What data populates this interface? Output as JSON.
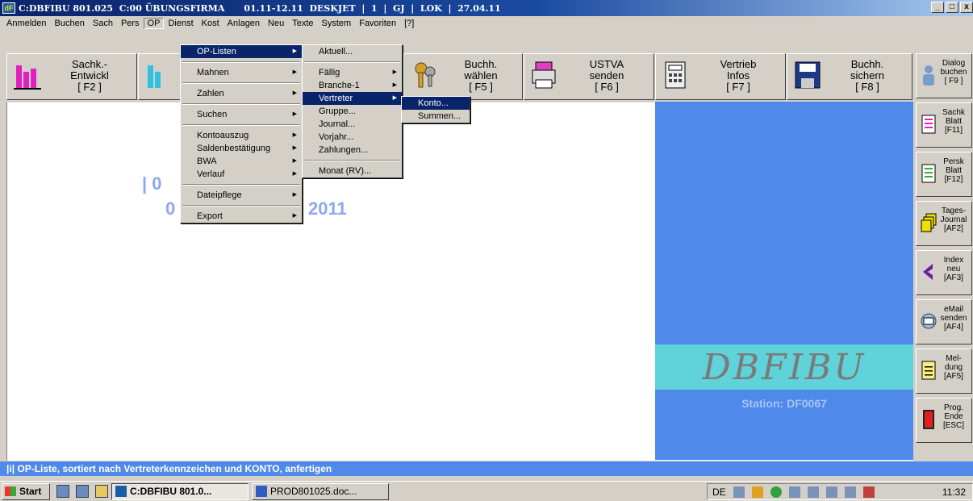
{
  "window": {
    "app_icon_label": "dF",
    "title_left": "C:DBFIBU 801.025  C:00 ÜBUNGSFIRMA",
    "title_right": "01.11-12.11  DESKJET  |  1  |  GJ  |  LOK  |  27.04.11",
    "minimize": "_",
    "maximize": "□",
    "close": "x"
  },
  "menubar": [
    "Anmelden",
    "Buchen",
    "Sach",
    "Pers",
    "OP",
    "Dienst",
    "Kost",
    "Anlagen",
    "Neu",
    "Texte",
    "System",
    "Favoriten",
    "[?]"
  ],
  "toolbar": [
    {
      "label": "Sachk.-\nEntwickl\n[ F2 ]",
      "icon": "bar-chart-icon"
    },
    {
      "label": "",
      "icon": "bar-chart-icon"
    },
    {
      "label": "Buchh.\nwählen\n[ F5 ]",
      "icon": "keys-icon"
    },
    {
      "label": "USTVA\nsenden\n[ F6 ]",
      "icon": "printer-icon"
    },
    {
      "label": "Vertrieb\nInfos\n[ F7 ]",
      "icon": "calculator-icon"
    },
    {
      "label": "Buchh.\nsichern\n[ F8 ]",
      "icon": "floppy-icon"
    }
  ],
  "sidebar": [
    {
      "label": "Dialog\nbuchen\n[ F9 ]",
      "icon": "person-icon"
    },
    {
      "label": "Sachk\nBlatt\n[F11]",
      "icon": "ledger-icon"
    },
    {
      "label": "Persk\nBlatt\n[F12]",
      "icon": "ledger-green-icon"
    },
    {
      "label": "Tages-\nJournal\n[AF2]",
      "icon": "journal-icon"
    },
    {
      "label": "Index\nneu\n[AF3]",
      "icon": "index-icon"
    },
    {
      "label": "eMail\nsenden\n[AF4]",
      "icon": "email-icon"
    },
    {
      "label": "Mel-\ndung\n[AF5]",
      "icon": "notepad-icon"
    },
    {
      "label": "Prog.\nEnde\n[ESC]",
      "icon": "exit-door-icon"
    }
  ],
  "canvas": {
    "bg_text_1": "|  0",
    "bg_text_2": "0",
    "bg_text_3": "2011",
    "logo": "DBFIBU",
    "station": "Station: DF0067"
  },
  "menu_op": [
    {
      "label": "OP-Listen",
      "arrow": true,
      "hl": true
    },
    {
      "sep": true
    },
    {
      "label": "Mahnen",
      "arrow": true
    },
    {
      "sep": true
    },
    {
      "label": "Zahlen",
      "arrow": true
    },
    {
      "sep": true
    },
    {
      "label": "Suchen",
      "arrow": true
    },
    {
      "sep": true
    },
    {
      "label": "Kontoauszug",
      "arrow": true
    },
    {
      "label": "Saldenbestätigung",
      "arrow": true
    },
    {
      "label": "BWA",
      "arrow": true
    },
    {
      "label": "Verlauf",
      "arrow": true
    },
    {
      "sep": true
    },
    {
      "label": "Dateipflege",
      "arrow": true
    },
    {
      "sep": true
    },
    {
      "label": "Export",
      "arrow": true
    }
  ],
  "menu_oplisten": [
    {
      "label": "Aktuell...",
      "arrow": false
    },
    {
      "sep": true
    },
    {
      "label": "Fällig",
      "arrow": true
    },
    {
      "label": "Branche-1",
      "arrow": true
    },
    {
      "label": "Vertreter",
      "arrow": true,
      "hl": true
    },
    {
      "label": "Gruppe...",
      "arrow": false
    },
    {
      "label": "Journal...",
      "arrow": false
    },
    {
      "label": "Vorjahr...",
      "arrow": false
    },
    {
      "label": "Zahlungen...",
      "arrow": false
    },
    {
      "sep": true
    },
    {
      "label": "Monat (RV)...",
      "arrow": false
    }
  ],
  "menu_vertreter": [
    {
      "label": "Konto...",
      "hl": true
    },
    {
      "label": "Summen..."
    }
  ],
  "statusline": "|i|  OP-Liste, sortiert nach Vertreterkennzeichen und KONTO, anfertigen",
  "taskbar": {
    "start": "Start",
    "task1": "C:DBFIBU 801.0...",
    "task2": "PROD801025.doc...",
    "lang": "DE",
    "clock": "11:32"
  }
}
